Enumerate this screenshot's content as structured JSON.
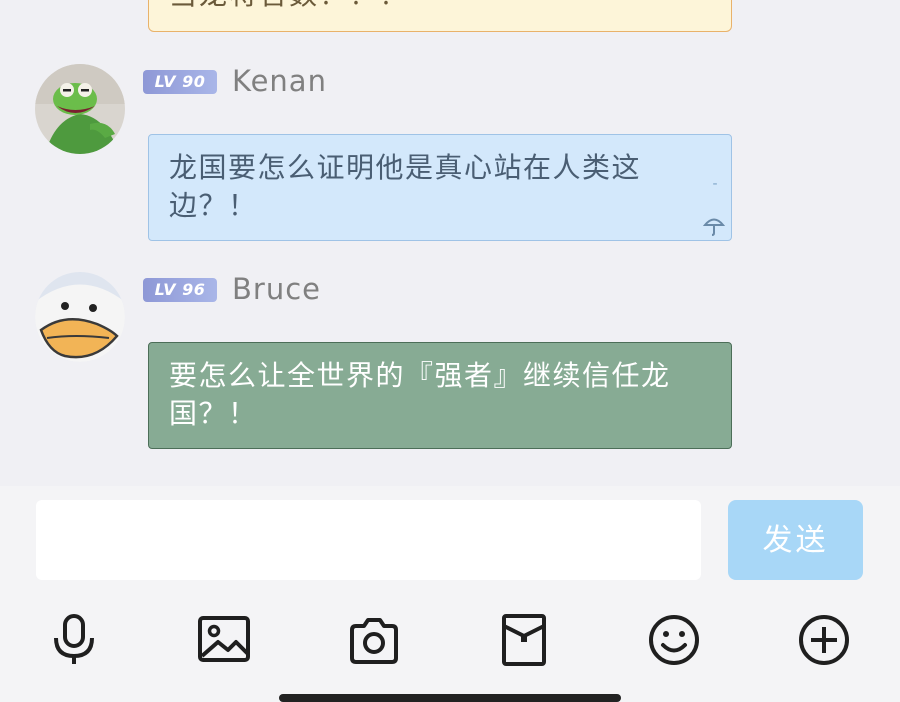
{
  "previous_message": {
    "text": "当龙将官数！！！"
  },
  "messages": [
    {
      "user": "Kenan",
      "level": "LV 90",
      "avatar_icon": "kermit-frog-avatar",
      "text": "龙国要怎么证明他是真心站在人类这边？！",
      "bubble_color": "#d3e8fb"
    },
    {
      "user": "Bruce",
      "level": "LV 96",
      "avatar_icon": "duck-avatar",
      "text": "要怎么让全世界的『强者』继续信任龙国？！",
      "bubble_color": "#87ab94"
    }
  ],
  "input": {
    "value": "",
    "placeholder": ""
  },
  "send_button": {
    "label": "发送",
    "color": "#a8d7f7"
  },
  "toolbar": {
    "icons": [
      "microphone-icon",
      "image-icon",
      "camera-icon",
      "red-envelope-icon",
      "emoji-icon",
      "plus-icon"
    ]
  }
}
